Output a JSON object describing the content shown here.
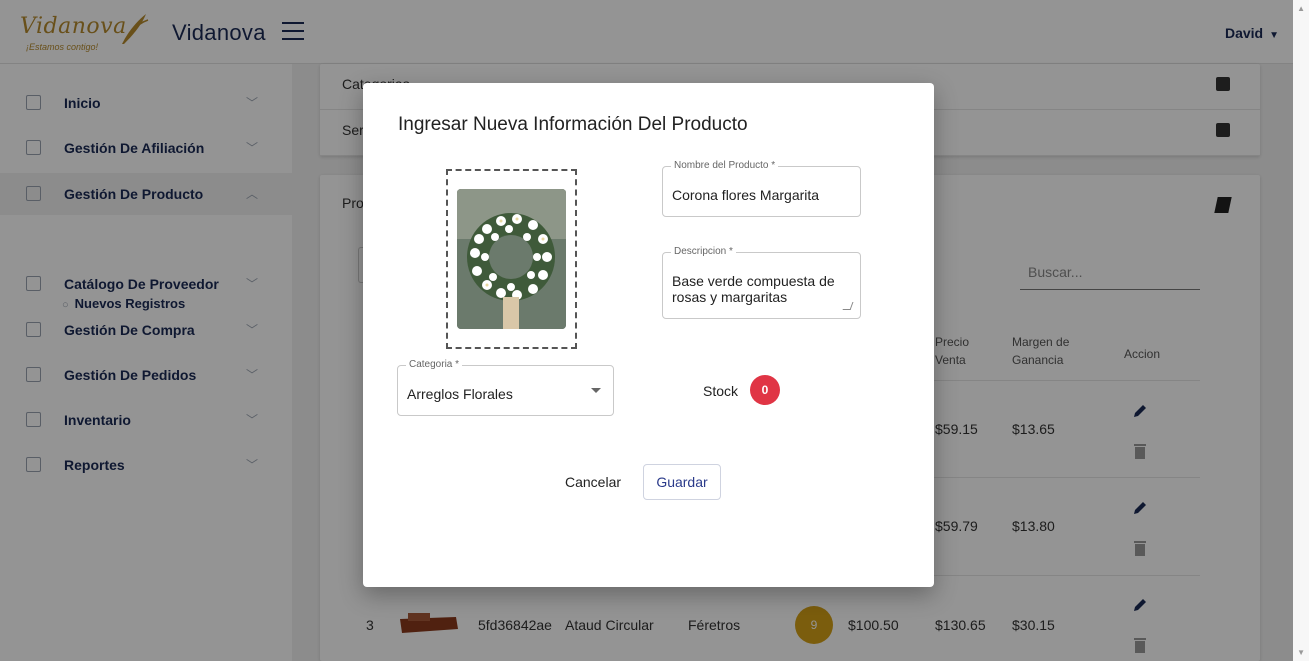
{
  "header": {
    "logo_text": "Vidanova",
    "logo_tagline": "¡Estamos contigo!",
    "brand": "Vidanova",
    "user": "David"
  },
  "sidebar": {
    "items": [
      {
        "label": "Inicio",
        "icon": "grid-icon"
      },
      {
        "label": "Gestión De Afiliación",
        "icon": "list-icon"
      },
      {
        "label": "Gestión De Producto",
        "icon": "box-icon"
      },
      {
        "label": "Catálogo De Proveedor",
        "icon": "document-icon"
      },
      {
        "label": "Gestión De Compra",
        "icon": "truck-icon"
      },
      {
        "label": "Gestión De Pedidos",
        "icon": "box-icon"
      },
      {
        "label": "Inventario",
        "icon": "list-icon"
      },
      {
        "label": "Reportes",
        "icon": "document-icon"
      }
    ],
    "subitem": "Nuevos Registros"
  },
  "main": {
    "card1": {
      "row1": "Categorias",
      "row2": "Ser"
    },
    "card2": {
      "title": "Pro",
      "search_placeholder": "Buscar...",
      "columns": {
        "precio_venta": "Precio Venta",
        "margen": "Margen de Ganancia",
        "accion": "Accion"
      },
      "rows": [
        {
          "precio_venta": "$59.15",
          "margen": "$13.65"
        },
        {
          "precio_venta": "$59.79",
          "margen": "$13.80"
        },
        {
          "num": "3",
          "code": "5fd36842ae",
          "name": "Ataud Circular",
          "category": "Féretros",
          "qty": "9",
          "price": "$100.50",
          "precio_venta": "$130.65",
          "margen": "$30.15"
        }
      ]
    }
  },
  "modal": {
    "title": "Ingresar Nueva Información Del Producto",
    "name_label": "Nombre del Producto *",
    "name_value": "Corona flores Margarita",
    "desc_label": "Descripcion *",
    "desc_value": "Base verde compuesta de rosas y margaritas",
    "category_label": "Categoria *",
    "category_value": "Arreglos Florales",
    "stock_label": "Stock",
    "stock_value": "0",
    "cancel": "Cancelar",
    "save": "Guardar"
  },
  "colors": {
    "accent": "#1a2a55",
    "stock_badge": "#e03545",
    "qty_badge": "#d4a017",
    "gold": "#b58a2e"
  }
}
